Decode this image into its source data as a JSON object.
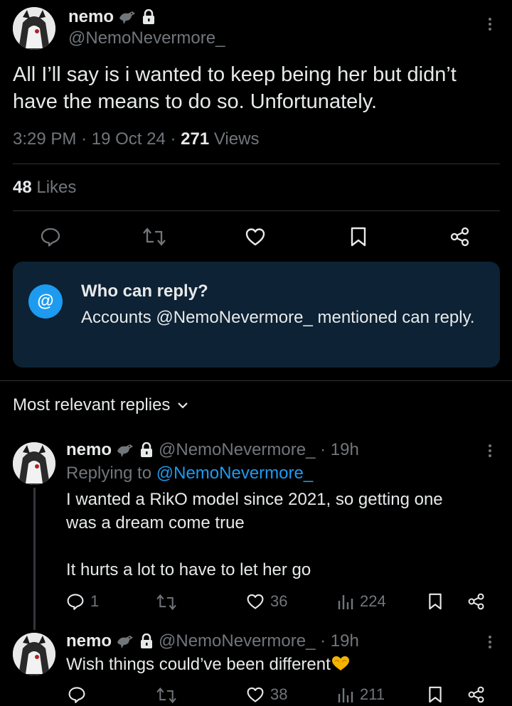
{
  "tweet": {
    "display_name": "nemo",
    "handle": "@NemoNevermore_",
    "text": "All I’ll say is i wanted to keep being her but didn’t have the means to do so. Unfortunately.",
    "time": "3:29 PM",
    "date": "19 Oct 24",
    "views_count": "271",
    "views_label": " Views",
    "likes_count": "48",
    "likes_label": " Likes"
  },
  "reply_restriction": {
    "title": "Who can reply?",
    "description": "Accounts @NemoNevermore_ mentioned can reply."
  },
  "replies_sort": {
    "label": "Most relevant replies"
  },
  "replies": [
    {
      "display_name": "nemo",
      "handle_time": "@NemoNevermore_ · 19h",
      "replying_prefix": "Replying to ",
      "replying_to": "@NemoNevermore_",
      "text_line1": "I wanted a RikO model since 2021, so getting one",
      "text_line2": "was a dream come true",
      "text_line3": "It hurts a lot to have to let her go",
      "reply_count": "1",
      "retweet_count": "",
      "like_count": "36",
      "view_count": "224"
    },
    {
      "display_name": "nemo",
      "handle_time": "@NemoNevermore_ · 19h",
      "text": "Wish things could’ve been different",
      "reply_count": "",
      "retweet_count": "",
      "like_count": "38",
      "view_count": "211"
    }
  ],
  "colors": {
    "background": "#000000",
    "text_primary": "#e7e9ea",
    "text_secondary": "#71767b",
    "accent": "#1d9bf0",
    "reply_box": "#0d2234",
    "divider": "#2f3336"
  }
}
